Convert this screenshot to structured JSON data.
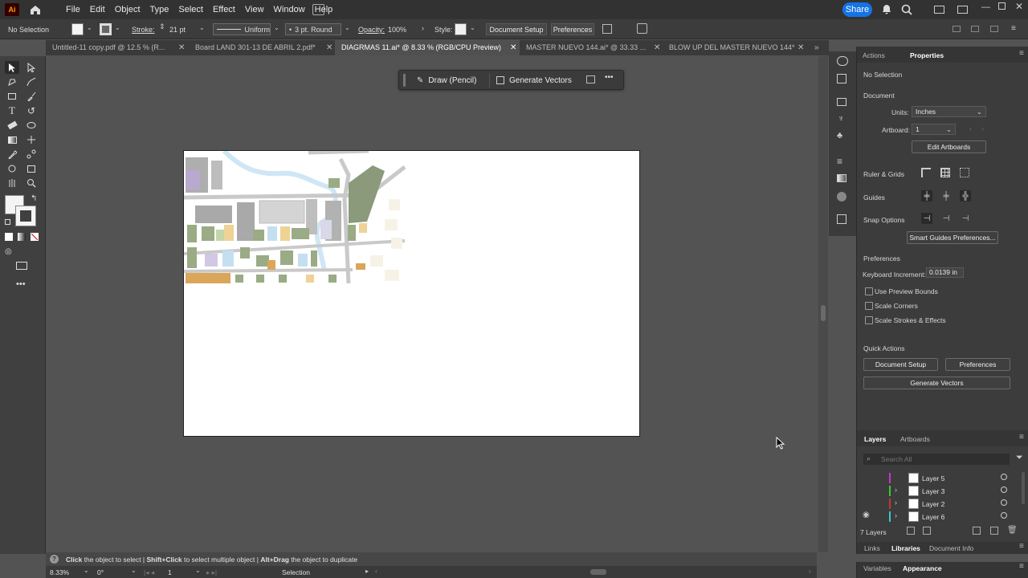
{
  "app": {
    "logo": "Ai"
  },
  "menus": [
    "File",
    "Edit",
    "Object",
    "Type",
    "Select",
    "Effect",
    "View",
    "Window",
    "Help"
  ],
  "share_label": "Share",
  "control": {
    "selection": "No Selection",
    "stroke_label": "Stroke:",
    "stroke_value": "21 pt",
    "uniform": "Uniform",
    "brush": "3 pt. Round",
    "opacity_label": "Opacity:",
    "opacity_value": "100%",
    "style_label": "Style:",
    "doc_setup": "Document Setup",
    "preferences": "Preferences"
  },
  "tabs": [
    {
      "label": "Untitled-11 copy.pdf @ 12.5 % (R...",
      "active": false
    },
    {
      "label": "Board LAND 301-13 DE ABRIL 2.pdf*",
      "active": false
    },
    {
      "label": "DIAGRMAS 11.ai* @ 8.33 % (RGB/CPU Preview)",
      "active": true
    },
    {
      "label": "MASTER NUEVO 144.ai* @ 33.33 ...",
      "active": false
    },
    {
      "label": "BLOW UP DEL MASTER NUEVO 144*",
      "active": false
    }
  ],
  "context_bar": {
    "draw": "Draw (Pencil)",
    "generate": "Generate Vectors",
    "more": "•••"
  },
  "panel": {
    "tabs": [
      "Actions",
      "Properties"
    ],
    "no_selection": "No Selection",
    "document": "Document",
    "units_label": "Units:",
    "units_value": "Inches",
    "artboard_label": "Artboard:",
    "artboard_value": "1",
    "edit_artboards": "Edit Artboards",
    "ruler_grids": "Ruler & Grids",
    "guides": "Guides",
    "snap": "Snap Options",
    "smart_guides": "Smart Guides Preferences...",
    "preferences": "Preferences",
    "kb_label": "Keyboard Increment:",
    "kb_value": "0.0139 in",
    "preview_bounds": "Use Preview Bounds",
    "scale_corners": "Scale Corners",
    "scale_strokes": "Scale Strokes & Effects",
    "quick_actions": "Quick Actions",
    "qa_doc_setup": "Document Setup",
    "qa_prefs": "Preferences",
    "qa_generate": "Generate Vectors"
  },
  "layers_panel": {
    "tabs": [
      "Layers",
      "Artboards"
    ],
    "search_placeholder": "Search All",
    "layers": [
      {
        "name": "Layer 5",
        "color": "#cc33cc",
        "expand": false,
        "visible": false
      },
      {
        "name": "Layer 3",
        "color": "#33cc33",
        "expand": true,
        "visible": false
      },
      {
        "name": "Layer 2",
        "color": "#cc3333",
        "expand": true,
        "visible": false
      },
      {
        "name": "Layer 6",
        "color": "#33cccc",
        "expand": true,
        "visible": true
      }
    ],
    "count": "7 Layers"
  },
  "bottom_tabs": {
    "row1": [
      "Links",
      "Libraries",
      "Document Info"
    ],
    "row2": [
      "Variables",
      "Appearance"
    ]
  },
  "hint": {
    "p1": "Click",
    "p2": " the object to select  |  ",
    "p3": "Shift+Click",
    "p4": " to select multiple object  |  ",
    "p5": "Alt+Drag",
    "p6": " the object to duplicate"
  },
  "status": {
    "zoom": "8.33%",
    "rotate": "0°",
    "artboard": "1",
    "tool": "Selection"
  }
}
